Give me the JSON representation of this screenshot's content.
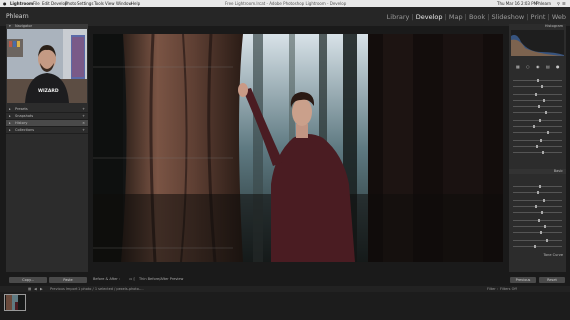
{
  "menubar": {
    "app": "Lightroom",
    "items": [
      "File",
      "Edit",
      "Develop",
      "Photo",
      "Settings",
      "Tools",
      "View",
      "Window",
      "Help"
    ],
    "title": "Free Lightroom.lrcat - Adobe Photoshop Lightroom - Develop",
    "clock": "Thu Mar 16 2:03 PM",
    "user": "Phlearn"
  },
  "identity": "Phlearn",
  "modules": [
    {
      "label": "Library",
      "active": false
    },
    {
      "label": "Develop",
      "active": true
    },
    {
      "label": "Map",
      "active": false
    },
    {
      "label": "Book",
      "active": false
    },
    {
      "label": "Slideshow",
      "active": false
    },
    {
      "label": "Print",
      "active": false
    },
    {
      "label": "Web",
      "active": false
    }
  ],
  "left_panel": {
    "navigator": "Navigator",
    "webcam_shirt": "WIZARD",
    "rows": [
      {
        "label": "Presets",
        "selected": false
      },
      {
        "label": "Snapshots",
        "selected": false
      },
      {
        "label": "History",
        "selected": true
      },
      {
        "label": "Collections",
        "selected": false
      }
    ],
    "copy": "Copy...",
    "paste": "Paste"
  },
  "toolbar": {
    "before_after": "Before & After :",
    "text": "Thin Before/After Preview"
  },
  "right_panel": {
    "histogram": "Histogram",
    "basic": "Basic",
    "tone_curve": "Tone Curve",
    "previous": "Previous",
    "reset": "Reset"
  },
  "filmstrip": {
    "info": "Previous Import",
    "count": "1 photo / 1 selected / pexels-photo-...",
    "filter": "Filter :",
    "filter_value": "Filters Off"
  }
}
